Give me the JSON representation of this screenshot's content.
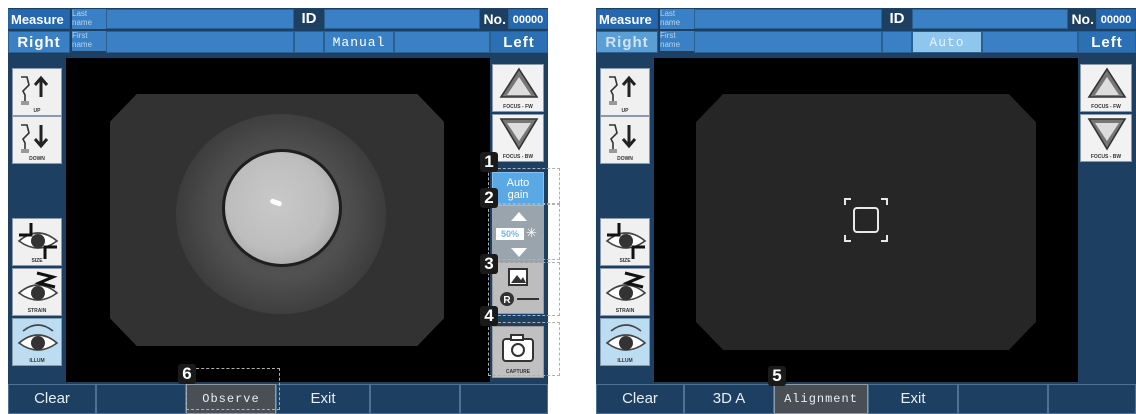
{
  "screens": [
    {
      "header": {
        "measure_label": "Measure",
        "last_name_label": "Last\nname",
        "first_name_label": "First\nname",
        "id_label": "ID",
        "no_label": "No.",
        "no_value": "00000",
        "right_label": "Right",
        "left_label": "Left",
        "mode": "Manual"
      },
      "left_tools": [
        {
          "label": "UP",
          "icon": "chin-up-icon"
        },
        {
          "label": "DOWN",
          "icon": "chin-down-icon"
        },
        {
          "label": "SIZE",
          "icon": "eye-size-icon"
        },
        {
          "label": "STRAIN",
          "icon": "eye-strain-icon"
        },
        {
          "label": "ILLUM",
          "icon": "eye-illum-icon"
        }
      ],
      "right_tools": {
        "focus_fw": "FOCUS - FW",
        "focus_bw": "FOCUS - BW",
        "auto_gain": "Auto\ngain",
        "gain_value": "50%",
        "capture": "CAPTURE"
      },
      "bottom": [
        {
          "label": "Clear"
        },
        {
          "label": ""
        },
        {
          "label": "Observe"
        },
        {
          "label": "Exit"
        },
        {
          "label": ""
        },
        {
          "label": ""
        }
      ],
      "callouts": [
        "1",
        "2",
        "3",
        "4",
        "6"
      ]
    },
    {
      "header": {
        "measure_label": "Measure",
        "last_name_label": "Last\nname",
        "first_name_label": "First\nname",
        "id_label": "ID",
        "no_label": "No.",
        "no_value": "00000",
        "right_label": "Right",
        "left_label": "Left",
        "mode": "Auto"
      },
      "right_tools": {
        "focus_fw": "FOCUS - FW",
        "focus_bw": "FOCUS - BW"
      },
      "bottom": [
        {
          "label": "Clear"
        },
        {
          "label": "3D A"
        },
        {
          "label": "Alignment"
        },
        {
          "label": "Exit"
        },
        {
          "label": ""
        },
        {
          "label": ""
        }
      ],
      "callouts": [
        "5"
      ]
    }
  ],
  "colors": {
    "panel_bg": "#1c3f62",
    "field_blue": "#3a80c4",
    "auto_active": "#8ec6ee",
    "auto_gain": "#5aa8e4"
  }
}
